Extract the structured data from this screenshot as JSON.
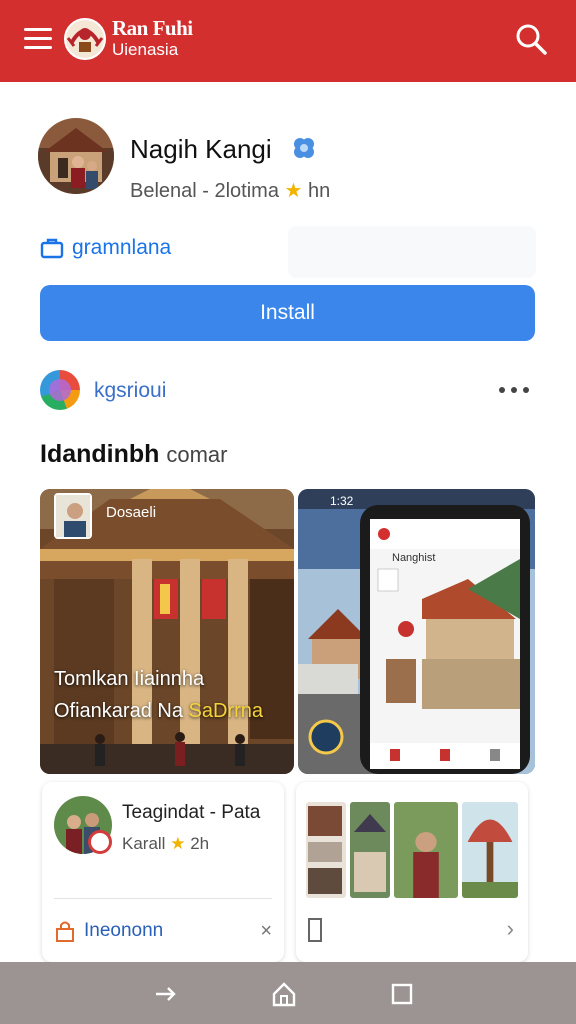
{
  "header": {
    "brand_line1": "Ran Fuhi",
    "brand_line2": "Uienasia",
    "menu_icon": "hamburger-menu-icon",
    "search_icon": "search-icon",
    "color": "#d42f2f"
  },
  "profile": {
    "name": "Nagih Kangi",
    "subtitle_pre": "Belenal - 2lotima",
    "subtitle_post": "hn",
    "verified_icon": "verified-badge-icon"
  },
  "link": {
    "label": "gramnlana",
    "icon": "briefcase-icon"
  },
  "install": {
    "label": "Install",
    "color": "#3a86ea"
  },
  "source": {
    "label": "kgsrioui",
    "more_icon": "more-horizontal-icon"
  },
  "section": {
    "title_bold": "Idandinbh",
    "title_light": "comar"
  },
  "media": {
    "left_label": "Dosaeli",
    "caption_line1": "Tomlkan  Iiainnha",
    "caption_line2_pre": "Ofiankarad Na ",
    "caption_line2_hl": "SaDrrna",
    "phone_status": "1:32",
    "phone_app_title": "Nanghist"
  },
  "card_left": {
    "title": "Teagindat - Pata",
    "sub": "Karall",
    "sub_post": "2h",
    "action": "Ineononn",
    "close": "×"
  },
  "card_right": {
    "chevron": "›"
  },
  "navbar": {
    "back_icon": "forward-arrow-icon",
    "home_icon": "home-icon",
    "recents_icon": "recents-square-icon"
  }
}
